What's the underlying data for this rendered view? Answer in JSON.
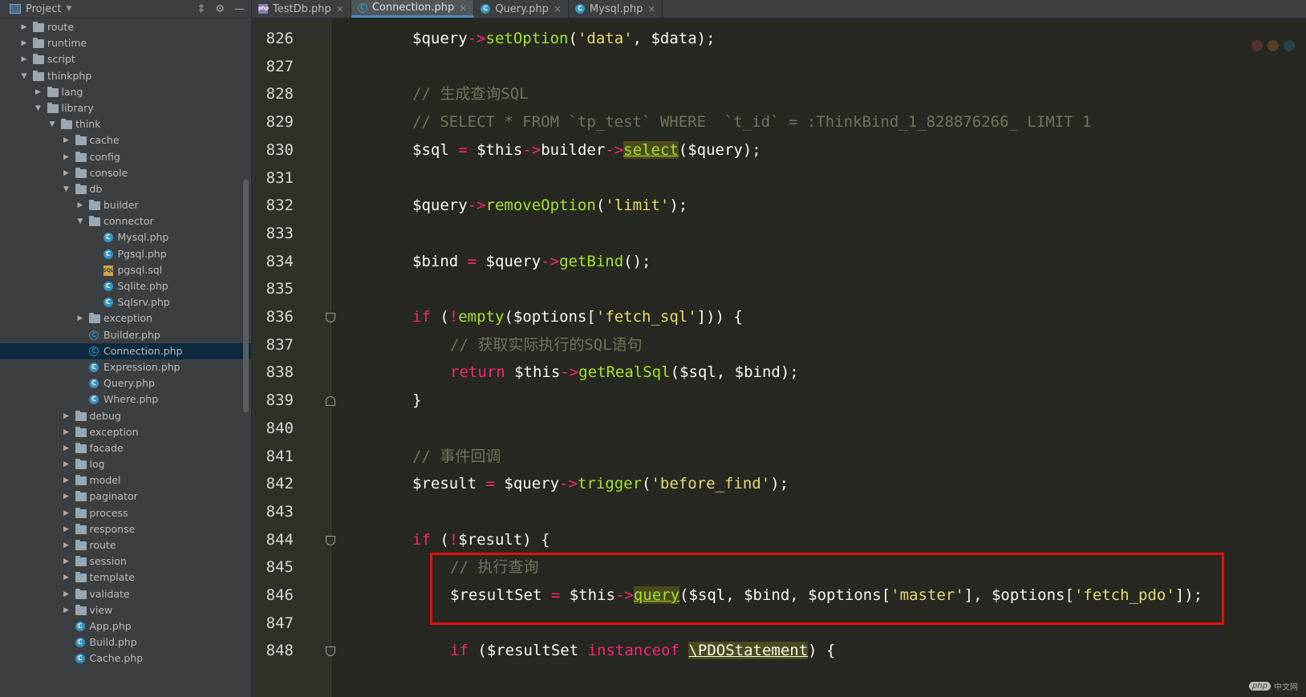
{
  "project": {
    "title": "Project",
    "tree": [
      {
        "label": "route",
        "type": "folder",
        "depth": 1,
        "arrow": "right"
      },
      {
        "label": "runtime",
        "type": "folder",
        "depth": 1,
        "arrow": "right"
      },
      {
        "label": "script",
        "type": "folder",
        "depth": 1,
        "arrow": "right"
      },
      {
        "label": "thinkphp",
        "type": "folder",
        "depth": 1,
        "arrow": "down"
      },
      {
        "label": "lang",
        "type": "folder",
        "depth": 2,
        "arrow": "right"
      },
      {
        "label": "library",
        "type": "folder",
        "depth": 2,
        "arrow": "down"
      },
      {
        "label": "think",
        "type": "folder",
        "depth": 3,
        "arrow": "down"
      },
      {
        "label": "cache",
        "type": "folder",
        "depth": 4,
        "arrow": "right"
      },
      {
        "label": "config",
        "type": "folder",
        "depth": 4,
        "arrow": "right"
      },
      {
        "label": "console",
        "type": "folder",
        "depth": 4,
        "arrow": "right"
      },
      {
        "label": "db",
        "type": "folder",
        "depth": 4,
        "arrow": "down"
      },
      {
        "label": "builder",
        "type": "folder",
        "depth": 5,
        "arrow": "right"
      },
      {
        "label": "connector",
        "type": "folder",
        "depth": 5,
        "arrow": "down"
      },
      {
        "label": "Mysql.php",
        "type": "class",
        "depth": 6
      },
      {
        "label": "Pgsql.php",
        "type": "class",
        "depth": 6
      },
      {
        "label": "pgsql.sql",
        "type": "sql",
        "depth": 6
      },
      {
        "label": "Sqlite.php",
        "type": "class",
        "depth": 6
      },
      {
        "label": "Sqlsrv.php",
        "type": "class",
        "depth": 6
      },
      {
        "label": "exception",
        "type": "folder",
        "depth": 5,
        "arrow": "right"
      },
      {
        "label": "Builder.php",
        "type": "abstract",
        "depth": 5
      },
      {
        "label": "Connection.php",
        "type": "abstract",
        "depth": 5,
        "selected": true
      },
      {
        "label": "Expression.php",
        "type": "class",
        "depth": 5
      },
      {
        "label": "Query.php",
        "type": "class",
        "depth": 5
      },
      {
        "label": "Where.php",
        "type": "class",
        "depth": 5
      },
      {
        "label": "debug",
        "type": "folder",
        "depth": 4,
        "arrow": "right"
      },
      {
        "label": "exception",
        "type": "folder",
        "depth": 4,
        "arrow": "right"
      },
      {
        "label": "facade",
        "type": "folder",
        "depth": 4,
        "arrow": "right"
      },
      {
        "label": "log",
        "type": "folder",
        "depth": 4,
        "arrow": "right"
      },
      {
        "label": "model",
        "type": "folder",
        "depth": 4,
        "arrow": "right"
      },
      {
        "label": "paginator",
        "type": "folder",
        "depth": 4,
        "arrow": "right"
      },
      {
        "label": "process",
        "type": "folder",
        "depth": 4,
        "arrow": "right"
      },
      {
        "label": "response",
        "type": "folder",
        "depth": 4,
        "arrow": "right"
      },
      {
        "label": "route",
        "type": "folder",
        "depth": 4,
        "arrow": "right"
      },
      {
        "label": "session",
        "type": "folder",
        "depth": 4,
        "arrow": "right"
      },
      {
        "label": "template",
        "type": "folder",
        "depth": 4,
        "arrow": "right"
      },
      {
        "label": "validate",
        "type": "folder",
        "depth": 4,
        "arrow": "right"
      },
      {
        "label": "view",
        "type": "folder",
        "depth": 4,
        "arrow": "right"
      },
      {
        "label": "App.php",
        "type": "class",
        "depth": 4
      },
      {
        "label": "Build.php",
        "type": "class",
        "depth": 4
      },
      {
        "label": "Cache.php",
        "type": "class",
        "depth": 4
      }
    ]
  },
  "tabs": [
    {
      "label": "TestDb.php",
      "icon": "php",
      "active": false
    },
    {
      "label": "Connection.php",
      "icon": "abstract",
      "active": true
    },
    {
      "label": "Query.php",
      "icon": "class",
      "active": false
    },
    {
      "label": "Mysql.php",
      "icon": "class",
      "active": false
    }
  ],
  "editor": {
    "lines": [
      {
        "n": "826",
        "indent": 1,
        "tokens": [
          [
            "v",
            "$query"
          ],
          [
            "kw",
            "->"
          ],
          [
            "fn",
            "setOption"
          ],
          [
            "p",
            "("
          ],
          [
            "str",
            "'data'"
          ],
          [
            "p",
            ", $data);"
          ]
        ]
      },
      {
        "n": "827",
        "indent": 0,
        "tokens": []
      },
      {
        "n": "828",
        "indent": 1,
        "tokens": [
          [
            "cm",
            "// 生成查询SQL"
          ]
        ]
      },
      {
        "n": "829",
        "indent": 1,
        "tokens": [
          [
            "cm",
            "// SELECT * FROM `tp_test` WHERE  `t_id` = :ThinkBind_1_828876266_ LIMIT 1"
          ]
        ]
      },
      {
        "n": "830",
        "indent": 1,
        "tokens": [
          [
            "v",
            "$sql "
          ],
          [
            "kw",
            "="
          ],
          [
            "v",
            " $this"
          ],
          [
            "kw",
            "->"
          ],
          [
            "v",
            "builder"
          ],
          [
            "kw",
            "->"
          ],
          [
            "hl",
            "select"
          ],
          [
            "p",
            "($query);"
          ]
        ]
      },
      {
        "n": "831",
        "indent": 0,
        "tokens": []
      },
      {
        "n": "832",
        "indent": 1,
        "tokens": [
          [
            "v",
            "$query"
          ],
          [
            "kw",
            "->"
          ],
          [
            "fn",
            "removeOption"
          ],
          [
            "p",
            "("
          ],
          [
            "str",
            "'limit'"
          ],
          [
            "p",
            ");"
          ]
        ]
      },
      {
        "n": "833",
        "indent": 0,
        "tokens": []
      },
      {
        "n": "834",
        "indent": 1,
        "tokens": [
          [
            "v",
            "$bind "
          ],
          [
            "kw",
            "="
          ],
          [
            "v",
            " $query"
          ],
          [
            "kw",
            "->"
          ],
          [
            "fn",
            "getBind"
          ],
          [
            "p",
            "();"
          ]
        ]
      },
      {
        "n": "835",
        "indent": 0,
        "tokens": []
      },
      {
        "n": "836",
        "indent": 1,
        "fold": "open",
        "tokens": [
          [
            "kw",
            "if"
          ],
          [
            "p",
            " ("
          ],
          [
            "kw",
            "!"
          ],
          [
            "fn",
            "empty"
          ],
          [
            "p",
            "($options["
          ],
          [
            "str",
            "'fetch_sql'"
          ],
          [
            "p",
            "])) {"
          ]
        ]
      },
      {
        "n": "837",
        "indent": 2,
        "tokens": [
          [
            "cm",
            "// 获取实际执行的SQL语句"
          ]
        ]
      },
      {
        "n": "838",
        "indent": 2,
        "tokens": [
          [
            "kw",
            "return"
          ],
          [
            "v",
            " $this"
          ],
          [
            "kw",
            "->"
          ],
          [
            "fn",
            "getRealSql"
          ],
          [
            "p",
            "($sql, $bind);"
          ]
        ]
      },
      {
        "n": "839",
        "indent": 1,
        "fold": "close",
        "tokens": [
          [
            "p",
            "}"
          ]
        ]
      },
      {
        "n": "840",
        "indent": 0,
        "tokens": []
      },
      {
        "n": "841",
        "indent": 1,
        "tokens": [
          [
            "cm",
            "// 事件回调"
          ]
        ]
      },
      {
        "n": "842",
        "indent": 1,
        "tokens": [
          [
            "v",
            "$result "
          ],
          [
            "kw",
            "="
          ],
          [
            "v",
            " $query"
          ],
          [
            "kw",
            "->"
          ],
          [
            "fn",
            "trigger"
          ],
          [
            "p",
            "("
          ],
          [
            "str",
            "'before_find'"
          ],
          [
            "p",
            ");"
          ]
        ]
      },
      {
        "n": "843",
        "indent": 0,
        "tokens": []
      },
      {
        "n": "844",
        "indent": 1,
        "fold": "open",
        "tokens": [
          [
            "kw",
            "if"
          ],
          [
            "p",
            " ("
          ],
          [
            "kw",
            "!"
          ],
          [
            "p",
            "$result) {"
          ]
        ]
      },
      {
        "n": "845",
        "indent": 2,
        "tokens": [
          [
            "cm",
            "// 执行查询"
          ]
        ]
      },
      {
        "n": "846",
        "indent": 2,
        "tokens": [
          [
            "v",
            "$resultSet "
          ],
          [
            "kw",
            "="
          ],
          [
            "v",
            " $this"
          ],
          [
            "kw",
            "->"
          ],
          [
            "hl",
            "query"
          ],
          [
            "p",
            "($sql, $bind, $options["
          ],
          [
            "str",
            "'master'"
          ],
          [
            "p",
            "], $options["
          ],
          [
            "str",
            "'fetch_pdo'"
          ],
          [
            "p",
            "]);"
          ]
        ]
      },
      {
        "n": "847",
        "indent": 0,
        "tokens": []
      },
      {
        "n": "848",
        "indent": 2,
        "fold": "open",
        "tokens": [
          [
            "kw",
            "if"
          ],
          [
            "p",
            " ($resultSet "
          ],
          [
            "kw",
            "instanceof"
          ],
          [
            "p",
            " "
          ],
          [
            "hl2",
            "\\PDOStatement"
          ],
          [
            "p",
            ") {"
          ]
        ]
      }
    ]
  },
  "watermark": {
    "logo": "php",
    "text": "中文网"
  },
  "colors": {
    "selection": "#0d293e",
    "highlight_box": "#e01010",
    "keyword": "#f92672",
    "function": "#a6e22e",
    "string": "#e6db74",
    "comment": "#75715e"
  }
}
